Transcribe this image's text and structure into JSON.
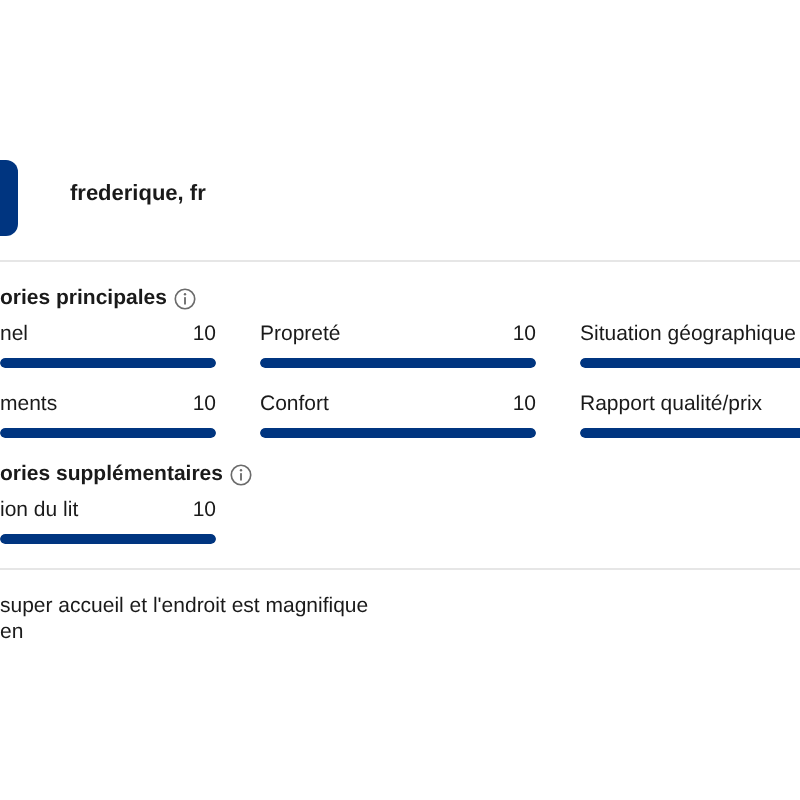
{
  "reviewer": {
    "name": "frederique, fr"
  },
  "main_categories": {
    "title": "ories principales",
    "items": [
      {
        "label": "nel",
        "score": "10",
        "level": 1
      },
      {
        "label": "Propreté",
        "score": "10",
        "level": 1
      },
      {
        "label": "Situation géographique",
        "level": 1
      },
      {
        "label": "ments",
        "score": "10",
        "level": 1
      },
      {
        "label": "Confort",
        "score": "10",
        "level": 1
      },
      {
        "label": "Rapport qualité/prix",
        "level": 1
      }
    ]
  },
  "extra_categories": {
    "title": "ories supplémentaires",
    "items": [
      {
        "label": "ion du lit",
        "score": "10",
        "level": 1
      }
    ]
  },
  "comment": {
    "lines": [
      "super accueil et l'endroit est magnifique",
      "en"
    ]
  }
}
